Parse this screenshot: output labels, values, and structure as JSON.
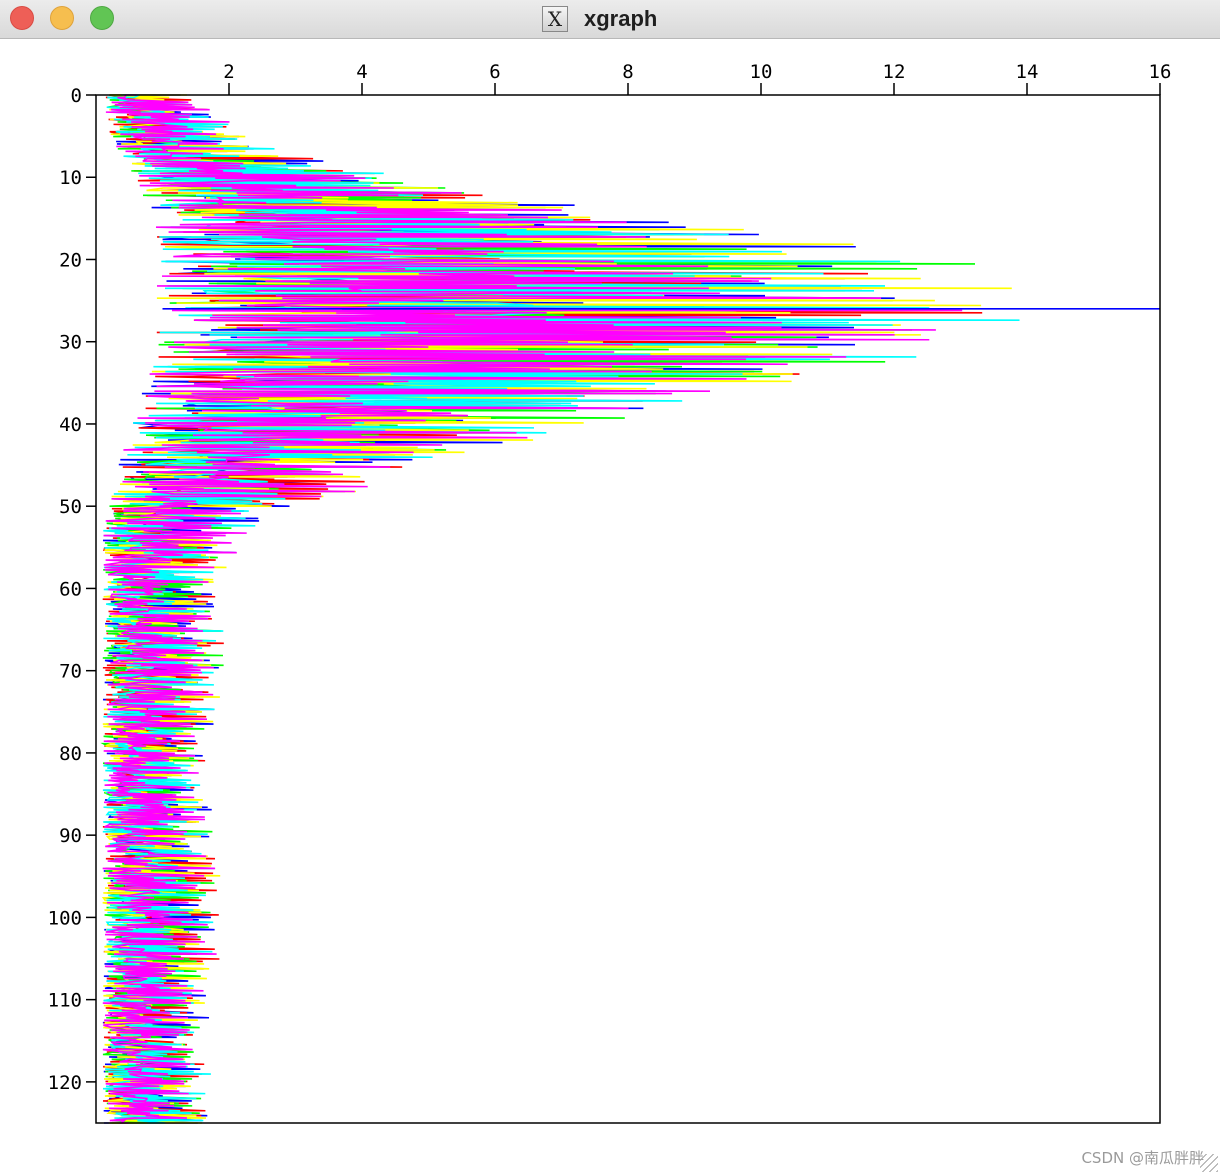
{
  "window": {
    "title": "xgraph",
    "app_icon": "x-window-icon"
  },
  "watermark": "CSDN @南瓜胖胖",
  "colors": {
    "series_palette": [
      "#0000ff",
      "#ff0000",
      "#00ff00",
      "#ffff00",
      "#00ffff",
      "#ff00ff"
    ],
    "axis": "#000000",
    "background": "#ffffff"
  },
  "chart_data": {
    "type": "line",
    "title": "",
    "xlabel": "",
    "ylabel": "",
    "x_axis_position": "top",
    "y_axis_inverted": true,
    "grid": false,
    "legend": "none",
    "xlim": [
      0,
      16
    ],
    "ylim": [
      0,
      125
    ],
    "x_ticks": [
      2,
      4,
      6,
      8,
      10,
      12,
      14,
      16
    ],
    "y_ticks": [
      0,
      10,
      20,
      30,
      40,
      50,
      60,
      70,
      80,
      90,
      100,
      110,
      120
    ],
    "series_count": 6,
    "series_style": "many overlapping noisy horizontal step traces; x = amplitude, y = depth (increasing downward)",
    "envelope": {
      "y": [
        0,
        5,
        8,
        10,
        13,
        15,
        17,
        20,
        23,
        26,
        28,
        30,
        33,
        36,
        40,
        43,
        46,
        50,
        53,
        56,
        60,
        70,
        80,
        90,
        100,
        110,
        120,
        125
      ],
      "x_max": [
        1.5,
        2.5,
        3.5,
        5.0,
        7.0,
        9.5,
        11.5,
        13.5,
        15.0,
        15.8,
        14.5,
        13.5,
        12.5,
        11.0,
        8.0,
        6.5,
        5.0,
        3.5,
        2.5,
        2.2,
        1.9,
        2.1,
        1.8,
        1.8,
        2.0,
        1.8,
        1.8,
        1.8
      ],
      "x_min": [
        0.1,
        0.2,
        0.3,
        0.5,
        0.7,
        0.9,
        0.9,
        0.9,
        0.9,
        0.9,
        0.9,
        0.8,
        0.8,
        0.7,
        0.5,
        0.4,
        0.3,
        0.2,
        0.1,
        0.1,
        0.1,
        0.1,
        0.1,
        0.1,
        0.1,
        0.1,
        0.1,
        0.1
      ]
    },
    "peak": {
      "x": 16,
      "y": 26
    }
  }
}
